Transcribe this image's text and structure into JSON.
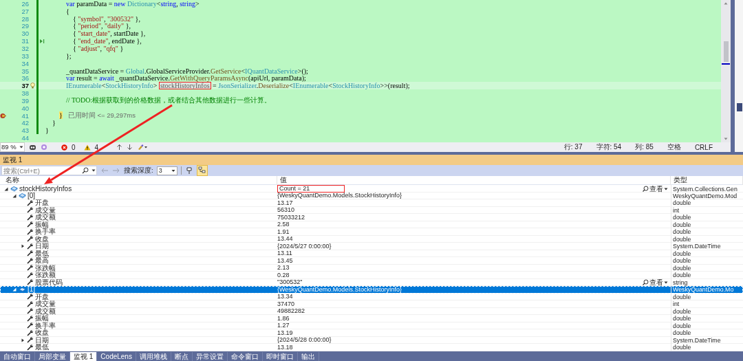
{
  "editor": {
    "lines": [
      {
        "number": "26",
        "current": false,
        "changed": true,
        "tokens": [
          {
            "t": "            var",
            "kind": "keyword"
          },
          {
            "t": " paramData = ",
            "kind": "plain"
          },
          {
            "t": "new",
            "kind": "keyword"
          },
          {
            "t": " Dictionary",
            "kind": "type"
          },
          {
            "t": "<",
            "kind": "plain"
          },
          {
            "t": "string",
            "kind": "keyword"
          },
          {
            "t": ", ",
            "kind": "plain"
          },
          {
            "t": "string",
            "kind": "keyword"
          },
          {
            "t": ">",
            "kind": "plain"
          }
        ]
      },
      {
        "number": "27",
        "current": false,
        "changed": true,
        "tokens": [
          {
            "t": "            {",
            "kind": "plain"
          }
        ]
      },
      {
        "number": "28",
        "current": false,
        "changed": true,
        "tokens": [
          {
            "t": "                { ",
            "kind": "plain"
          },
          {
            "t": "\"symbol\"",
            "kind": "string"
          },
          {
            "t": ", ",
            "kind": "plain"
          },
          {
            "t": "\"300532\"",
            "kind": "string"
          },
          {
            "t": " },",
            "kind": "plain"
          }
        ]
      },
      {
        "number": "29",
        "current": false,
        "changed": true,
        "tokens": [
          {
            "t": "                { ",
            "kind": "plain"
          },
          {
            "t": "\"period\"",
            "kind": "string"
          },
          {
            "t": ", ",
            "kind": "plain"
          },
          {
            "t": "\"daily\"",
            "kind": "string"
          },
          {
            "t": " },",
            "kind": "plain"
          }
        ]
      },
      {
        "number": "30",
        "current": false,
        "changed": true,
        "tokens": [
          {
            "t": "                { ",
            "kind": "plain"
          },
          {
            "t": "\"start_date\"",
            "kind": "string"
          },
          {
            "t": ", startDate },",
            "kind": "plain"
          }
        ]
      },
      {
        "number": "31",
        "current": false,
        "changed": true,
        "marker": {
          "kind": "run_to_click"
        },
        "tokens": [
          {
            "t": "                { ",
            "kind": "plain"
          },
          {
            "t": "\"end_date\"",
            "kind": "string"
          },
          {
            "t": ", endDate },",
            "kind": "plain"
          }
        ]
      },
      {
        "number": "32",
        "current": false,
        "changed": true,
        "tokens": [
          {
            "t": "                { ",
            "kind": "plain"
          },
          {
            "t": "\"adjust\"",
            "kind": "string"
          },
          {
            "t": ", ",
            "kind": "plain"
          },
          {
            "t": "\"qfq\"",
            "kind": "string"
          },
          {
            "t": " }",
            "kind": "plain"
          }
        ]
      },
      {
        "number": "33",
        "current": false,
        "changed": true,
        "tokens": [
          {
            "t": "            };",
            "kind": "plain"
          }
        ]
      },
      {
        "number": "34",
        "current": false,
        "changed": true
      },
      {
        "number": "35",
        "current": false,
        "changed": true,
        "tokens": [
          {
            "t": "            _quantDataService = ",
            "kind": "plain"
          },
          {
            "t": "Global",
            "kind": "type"
          },
          {
            "t": ".GlobalServiceProvider.",
            "kind": "plain"
          },
          {
            "t": "GetService",
            "kind": "method"
          },
          {
            "t": "<",
            "kind": "plain"
          },
          {
            "t": "IQuantDataService",
            "kind": "type"
          },
          {
            "t": ">();",
            "kind": "plain"
          }
        ]
      },
      {
        "number": "36",
        "current": false,
        "changed": true,
        "tokens": [
          {
            "t": "            var",
            "kind": "keyword"
          },
          {
            "t": " result = ",
            "kind": "plain"
          },
          {
            "t": "await",
            "kind": "keyword"
          },
          {
            "t": " _quantDataService.",
            "kind": "plain"
          },
          {
            "t": "GetWithQueryParamsAsync",
            "kind": "method"
          },
          {
            "t": "(apiUrl, paramData);",
            "kind": "plain"
          }
        ]
      },
      {
        "number": "37",
        "current": true,
        "changed": true,
        "marker": {
          "kind": "lightbulb"
        },
        "tokens": [
          {
            "t": "            IEnumerable",
            "kind": "type"
          },
          {
            "t": "<",
            "kind": "plain"
          },
          {
            "t": "StockHistoryInfo",
            "kind": "type"
          },
          {
            "t": "> ",
            "kind": "plain"
          },
          {
            "t": "stockHistoryInfos",
            "kind": "variable",
            "marked": true
          },
          {
            "t": " = ",
            "kind": "plain"
          },
          {
            "t": "JsonSerializer",
            "kind": "type"
          },
          {
            "t": ".",
            "kind": "plain"
          },
          {
            "t": "Deserialize",
            "kind": "method"
          },
          {
            "t": "<",
            "kind": "plain"
          },
          {
            "t": "IEnumerable",
            "kind": "type"
          },
          {
            "t": "<",
            "kind": "plain"
          },
          {
            "t": "StockHistoryInfo",
            "kind": "type"
          },
          {
            "t": ">>(result);",
            "kind": "plain"
          }
        ]
      },
      {
        "number": "38",
        "current": false,
        "changed": true
      },
      {
        "number": "39",
        "current": false,
        "changed": true,
        "tokens": [
          {
            "t": "            // TODO:根据获取到的价格数据，或者结合其他数据进行一些计算。",
            "kind": "comment"
          }
        ]
      },
      {
        "number": "40",
        "current": false,
        "changed": true
      },
      {
        "number": "41",
        "current": false,
        "changed": true,
        "marker": {
          "kind": "execution"
        },
        "tokens": [
          {
            "t": "        }",
            "kind": "brace_current"
          },
          {
            "t": "已用时间 <= 29,297ms",
            "kind": "hint"
          }
        ]
      },
      {
        "number": "42",
        "current": false,
        "changed": true,
        "tokens": [
          {
            "t": "    }",
            "kind": "plain"
          }
        ]
      },
      {
        "number": "43",
        "current": false,
        "changed": true,
        "tokens": [
          {
            "t": "}",
            "kind": "plain"
          }
        ]
      },
      {
        "number": "44",
        "current": false,
        "changed": false
      }
    ],
    "zoom": "89 %",
    "errors": "0",
    "warnings": "4",
    "status": [
      "行: 37",
      "字符: 54",
      "列: 85",
      "空格",
      "CRLF"
    ]
  },
  "watch": {
    "title": "监视 1",
    "search": {
      "placeholder": "搜索(Ctrl+E)"
    },
    "depth_label": "搜索深度:",
    "depth": "3",
    "toggle_on": true,
    "columns": [
      "名称",
      "值",
      "类型"
    ],
    "rows": [
      {
        "name": "stockHistoryInfos",
        "value": "Count = 21",
        "value_marked": true,
        "type": "System.Collections.Gen",
        "kind": "object",
        "expanded": true,
        "selected": false,
        "visualizer": "查看",
        "children": [
          {
            "name": "[0]",
            "value": "{WeskyQuantDemo.Models.StockHistoryInfo}",
            "type": "WeskyQuantDemo.Mod",
            "kind": "object",
            "expanded": true,
            "selected": false,
            "children": [
              {
                "name": "开盘",
                "value": "13.17",
                "type": "double",
                "kind": "property",
                "selected": false
              },
              {
                "name": "成交量",
                "value": "56310",
                "type": "int",
                "kind": "property",
                "selected": false
              },
              {
                "name": "成交额",
                "value": "75033212",
                "type": "double",
                "kind": "property",
                "selected": false
              },
              {
                "name": "振幅",
                "value": "2.58",
                "type": "double",
                "kind": "property",
                "selected": false
              },
              {
                "name": "换手率",
                "value": "1.91",
                "type": "double",
                "kind": "property",
                "selected": false
              },
              {
                "name": "收盘",
                "value": "13.44",
                "type": "double",
                "kind": "property",
                "selected": false
              },
              {
                "name": "日期",
                "value": "{2024/5/27 0:00:00}",
                "type": "System.DateTime",
                "kind": "property",
                "expanded": false,
                "selected": false
              },
              {
                "name": "最低",
                "value": "13.11",
                "type": "double",
                "kind": "property",
                "selected": false
              },
              {
                "name": "最高",
                "value": "13.45",
                "type": "double",
                "kind": "property",
                "selected": false
              },
              {
                "name": "张跌幅",
                "value": "2.13",
                "type": "double",
                "kind": "property",
                "selected": false
              },
              {
                "name": "张跌额",
                "value": "0.28",
                "type": "double",
                "kind": "property",
                "selected": false
              },
              {
                "name": "股票代码",
                "value": "\"300532\"",
                "type": "string",
                "kind": "property",
                "selected": false,
                "visualizer": "查看"
              }
            ]
          },
          {
            "name": "[1]",
            "value": "{WeskyQuantDemo.Models.StockHistoryInfo}",
            "type": "WeskyQuantDemo.Mo",
            "kind": "object",
            "expanded": true,
            "selected": true,
            "children": [
              {
                "name": "开盘",
                "value": "13.34",
                "type": "double",
                "kind": "property",
                "selected": false
              },
              {
                "name": "成交量",
                "value": "37470",
                "type": "int",
                "kind": "property",
                "selected": false
              },
              {
                "name": "成交额",
                "value": "49882282",
                "type": "double",
                "kind": "property",
                "selected": false
              },
              {
                "name": "振幅",
                "value": "1.86",
                "type": "double",
                "kind": "property",
                "selected": false
              },
              {
                "name": "换手率",
                "value": "1.27",
                "type": "double",
                "kind": "property",
                "selected": false
              },
              {
                "name": "收盘",
                "value": "13.19",
                "type": "double",
                "kind": "property",
                "selected": false
              },
              {
                "name": "日期",
                "value": "{2024/5/28 0:00:00}",
                "type": "System.DateTime",
                "kind": "property",
                "expanded": false,
                "selected": false
              },
              {
                "name": "最低",
                "value": "13.18",
                "type": "double",
                "kind": "property",
                "selected": false
              }
            ]
          }
        ]
      }
    ]
  },
  "bottom_tabs": [
    {
      "label": "自动窗口",
      "selected": false
    },
    {
      "label": "局部变量",
      "selected": false
    },
    {
      "label": "监视 1",
      "selected": true
    },
    {
      "label": "CodeLens",
      "selected": false
    },
    {
      "label": "调用堆栈",
      "selected": false
    },
    {
      "label": "断点",
      "selected": false
    },
    {
      "label": "异常设置",
      "selected": false
    },
    {
      "label": "命令窗口",
      "selected": false
    },
    {
      "label": "即时窗口",
      "selected": false
    },
    {
      "label": "输出",
      "selected": false
    }
  ]
}
